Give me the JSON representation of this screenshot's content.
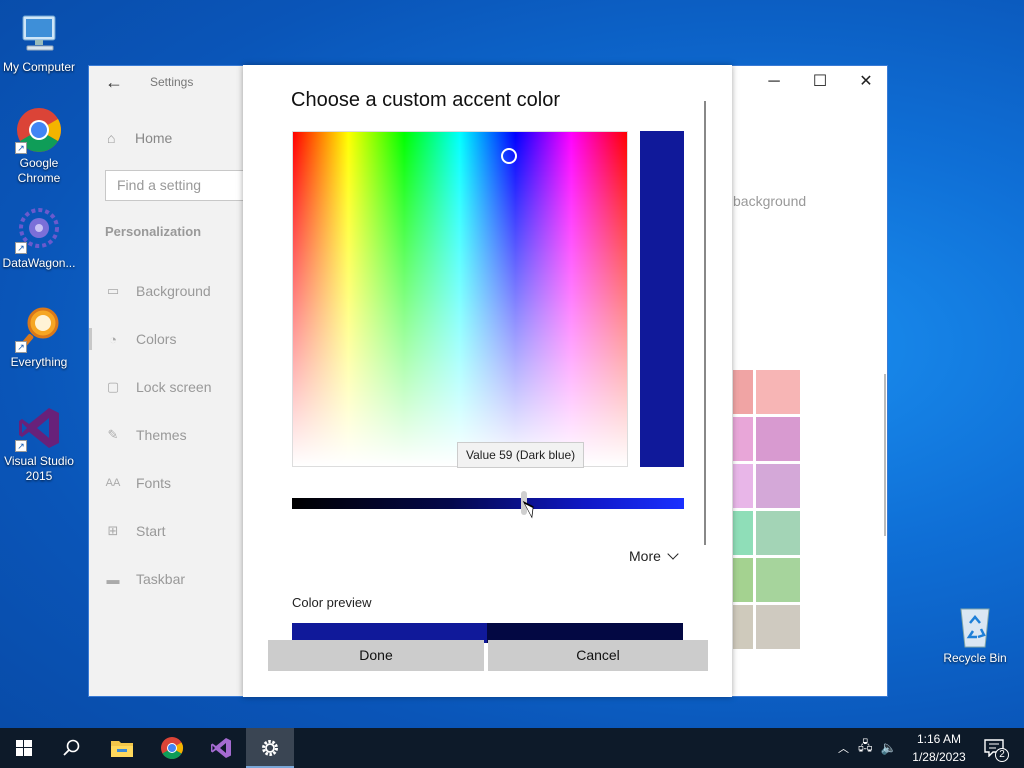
{
  "desktop": {
    "icons": [
      {
        "label": "My Computer"
      },
      {
        "label": "Google Chrome"
      },
      {
        "label": "DataWagon..."
      },
      {
        "label": "Everything"
      },
      {
        "label": "Visual Studio 2015"
      },
      {
        "label": "Recycle Bin"
      }
    ]
  },
  "settings": {
    "title": "Settings",
    "home": "Home",
    "search_placeholder": "Find a setting",
    "section": "Personalization",
    "nav": [
      {
        "label": "Background",
        "icon": "picture-icon"
      },
      {
        "label": "Colors",
        "icon": "palette-icon"
      },
      {
        "label": "Lock screen",
        "icon": "monitor-icon"
      },
      {
        "label": "Themes",
        "icon": "brush-icon"
      },
      {
        "label": "Fonts",
        "icon": "font-icon"
      },
      {
        "label": "Start",
        "icon": "start-icon"
      },
      {
        "label": "Taskbar",
        "icon": "taskbar-icon"
      }
    ],
    "partial_text": "background",
    "swatches": [
      "#f0a4a4",
      "#f7b5b5",
      "#e8a6d8",
      "#d89ad0",
      "#e8b6e8",
      "#d4a8d8",
      "#8fdeb8",
      "#a3d4b6",
      "#a4d290",
      "#a6d49c",
      "#cfcabc",
      "#cfcac0"
    ]
  },
  "dialog": {
    "title": "Choose a custom accent color",
    "selected_color": "#10199a",
    "tooltip": "Value 59 (Dark blue)",
    "slider_value": 59,
    "more": "More",
    "preview_label": "Color preview",
    "preview_light": "#10199a",
    "preview_dark": "#030843",
    "done": "Done",
    "cancel": "Cancel"
  },
  "taskbar": {
    "apps": [
      "start-icon",
      "search-icon",
      "file-explorer-icon",
      "chrome-icon",
      "visual-studio-icon",
      "settings-icon"
    ],
    "time": "1:16 AM",
    "date": "1/28/2023",
    "notifications": "2"
  }
}
